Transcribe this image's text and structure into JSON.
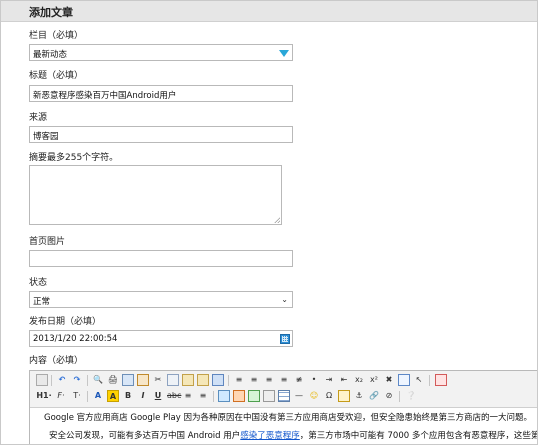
{
  "header": {
    "title": "添加文章"
  },
  "form": {
    "category": {
      "label": "栏目（必填）",
      "value": "最新动态"
    },
    "title": {
      "label": "标题（必填）",
      "value": "新恶意程序感染百万中国Android用户"
    },
    "source": {
      "label": "来源",
      "value": "博客园"
    },
    "summary": {
      "label": "摘要最多255个字符。",
      "value": ""
    },
    "cover": {
      "label": "首页图片",
      "value": ""
    },
    "status": {
      "label": "状态",
      "value": "正常"
    },
    "publish_date": {
      "label": "发布日期（必填）",
      "value": "2013/1/20 22:00:54"
    },
    "content": {
      "label": "内容（必填）"
    }
  },
  "editor": {
    "font_size_label": "H1·",
    "style_label": "F·",
    "text_size_label": "T·",
    "paragraph1": "Google 官方应用商店 Google Play 因为各种原因在中国没有第三方应用商店受欢迎，但安全隐患始终是第三方商店的一大问题。",
    "paragraph2_before": "安全公司发现，可能有多达百万中国 Android 用户",
    "paragraph2_link": "感染了恶意程序",
    "paragraph2_after": "，第三方市场中可能有 7000 多个应用包含有恶意程序，这些第三"
  },
  "colors": {
    "header_bg": "#e6e6e6",
    "select_arrow": "#2aa7d8",
    "link": "#1155cc"
  }
}
